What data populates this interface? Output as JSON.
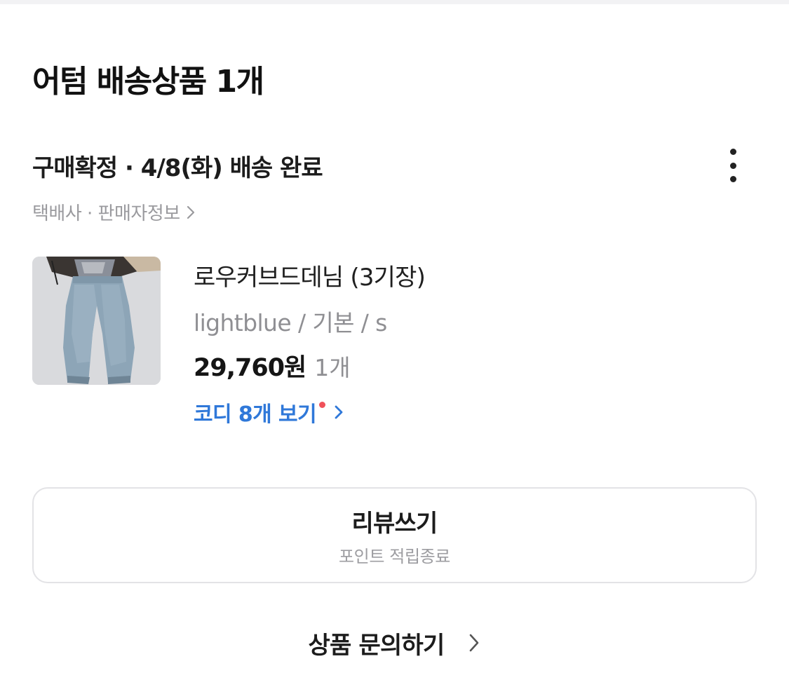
{
  "section": {
    "title": "어텀 배송상품 1개"
  },
  "order": {
    "status": "구매확정 · 4/8(화) 배송 완료",
    "sub_links": "택배사 · 판매자정보",
    "more_icon": "more-vertical-icon"
  },
  "product": {
    "name": "로우커브드데님 (3기장)",
    "option": "lightblue / 기본 / s",
    "price": "29,760원",
    "quantity": "1개",
    "cody_link": "코디 8개 보기",
    "thumbnail": "denim-pants-photo"
  },
  "actions": {
    "review_label": "리뷰쓰기",
    "review_sub": "포인트 적립종료",
    "inquiry_label": "상품 문의하기"
  },
  "colors": {
    "link_blue": "#2f78d9",
    "notify_red": "#f0515a",
    "muted_gray": "#9a9a9e"
  }
}
